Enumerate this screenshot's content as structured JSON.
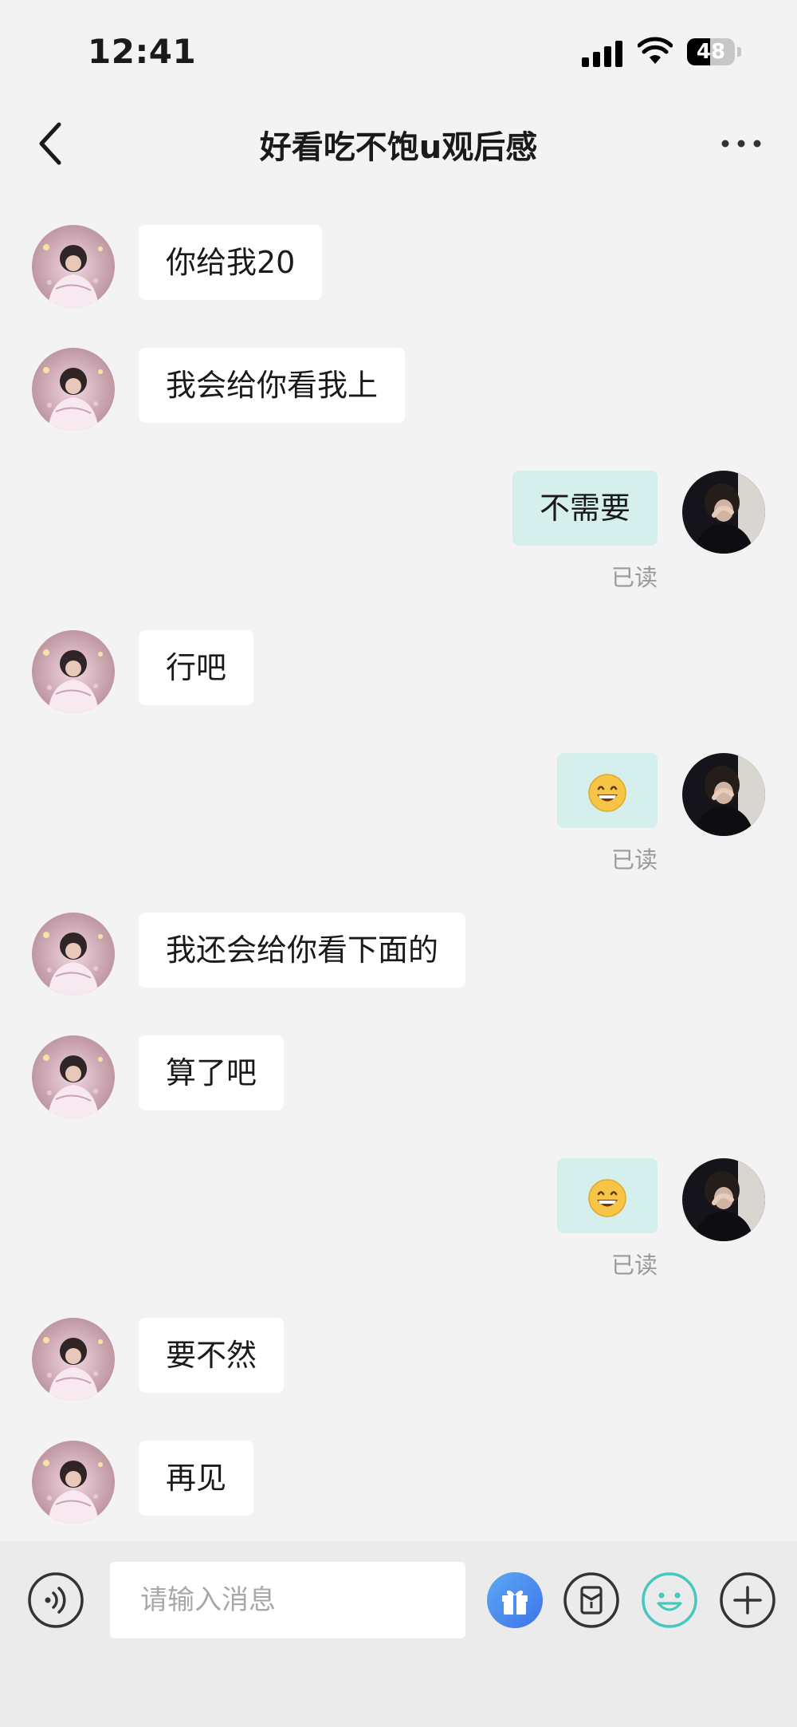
{
  "status_bar": {
    "time": "12:41",
    "battery": "48",
    "battery_level": 0.48
  },
  "header": {
    "title": "好看吃不饱u观后感"
  },
  "messages": [
    {
      "side": "in",
      "text": "你给我20"
    },
    {
      "side": "in",
      "text": "我会给你看我上"
    },
    {
      "side": "out",
      "text": "不需要",
      "status": "已读"
    },
    {
      "side": "in",
      "text": "行吧"
    },
    {
      "side": "out",
      "emoji": "grinning-face",
      "status": "已读"
    },
    {
      "side": "in",
      "text": "我还会给你看下面的"
    },
    {
      "side": "in",
      "text": "算了吧"
    },
    {
      "side": "out",
      "emoji": "grinning-face",
      "status": "已读"
    },
    {
      "side": "in",
      "text": "要不然"
    },
    {
      "side": "in",
      "text": "再见"
    }
  ],
  "input": {
    "placeholder": "请输入消息"
  },
  "colors": {
    "outgoing_bubble": "#d5efec",
    "incoming_bubble": "#ffffff",
    "accent_teal": "#46c7bf",
    "gift_blue": "#4a8ff0"
  }
}
